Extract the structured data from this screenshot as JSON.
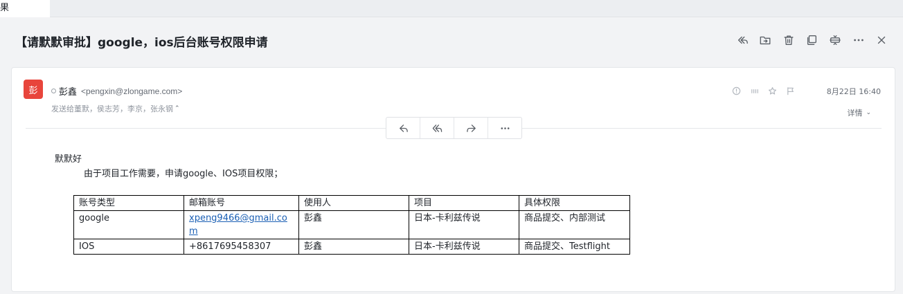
{
  "tab": {
    "label": "果"
  },
  "subject": "【请默默审批】google，ios后台账号权限申请",
  "toolbar": [
    {
      "name": "reply-all-icon"
    },
    {
      "name": "move-to-folder-icon"
    },
    {
      "name": "delete-icon"
    },
    {
      "name": "open-new-window-icon"
    },
    {
      "name": "fold-icon"
    },
    {
      "name": "more-icon"
    },
    {
      "name": "close-icon"
    }
  ],
  "message": {
    "avatar_text": "彭",
    "avatar_color": "#e8453c",
    "sender_name": "彭鑫",
    "sender_email": "<pengxin@zlongame.com>",
    "recipients": "发送给董默，侯志芳，李京，张永钢",
    "recipients_toggle": "⌃",
    "date": "8月22日 16:40",
    "details_label": "详情",
    "greeting": "默默好",
    "body_line": "由于项目工作需要，申请google、IOS项目权限；"
  },
  "table": {
    "headers": [
      "账号类型",
      "邮箱账号",
      "使用人",
      "项目",
      "具体权限"
    ],
    "rows": [
      [
        "google",
        "xpeng9466@gmail.com",
        "彭鑫",
        "日本-卡利兹传说",
        "商品提交、内部测试"
      ],
      [
        "IOS",
        "+8617695458307",
        "彭鑫",
        "日本-卡利兹传说",
        "商品提交、Testflight"
      ]
    ]
  }
}
